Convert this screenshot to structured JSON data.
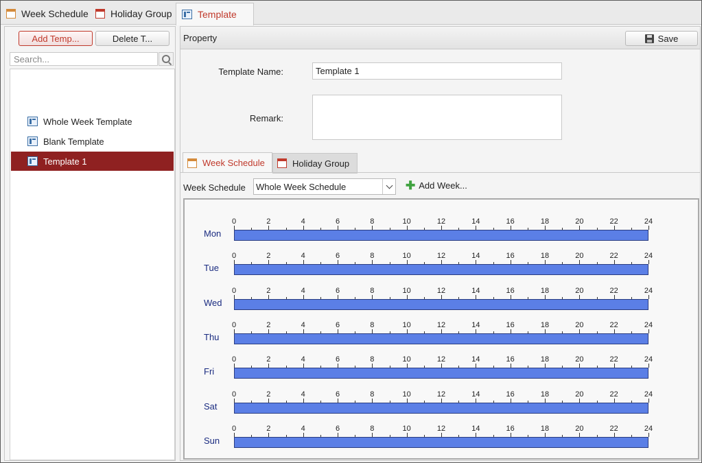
{
  "top_tabs": [
    {
      "label": "Week Schedule",
      "icon": "calendar-icon"
    },
    {
      "label": "Holiday Group",
      "icon": "calendar-red-icon"
    },
    {
      "label": "Template",
      "icon": "template-icon"
    }
  ],
  "left_panel": {
    "add_button": "Add Temp...",
    "delete_button": "Delete T...",
    "search_placeholder": "Search...",
    "items": [
      {
        "label": "Whole Week Template"
      },
      {
        "label": "Blank Template"
      },
      {
        "label": "Template 1",
        "selected": true
      }
    ]
  },
  "right_panel": {
    "header": "Property",
    "save_label": "Save",
    "template_name_label": "Template Name:",
    "template_name_value": "Template 1",
    "remark_label": "Remark:",
    "remark_value": "",
    "sub_tabs": [
      {
        "label": "Week Schedule",
        "active": true
      },
      {
        "label": "Holiday Group",
        "active": false
      }
    ],
    "week_schedule_label": "Week Schedule",
    "week_schedule_value": "Whole Week Schedule",
    "add_week_label": "Add Week...",
    "days": [
      "Mon",
      "Tue",
      "Wed",
      "Thu",
      "Fri",
      "Sat",
      "Sun"
    ],
    "hour_labels": [
      "0",
      "2",
      "4",
      "6",
      "8",
      "10",
      "12",
      "14",
      "16",
      "18",
      "20",
      "22",
      "24"
    ],
    "schedule_hours": [
      0,
      24
    ]
  },
  "colors": {
    "accent": "#c0392b",
    "selected_row": "#8f2121",
    "bar": "#5b7fe6",
    "day_label": "#1a2b80"
  }
}
